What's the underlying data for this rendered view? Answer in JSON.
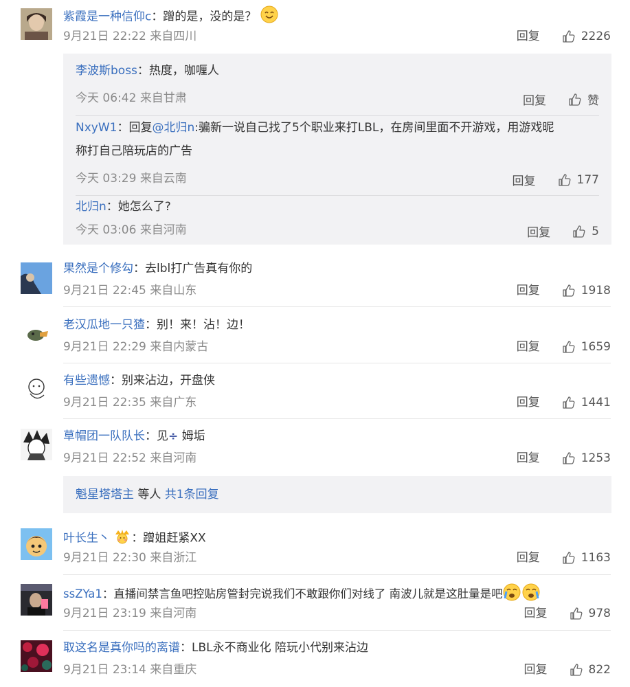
{
  "colors": {
    "link": "#3a6fbe",
    "meta": "#8a8a8a",
    "reply_bg": "#f2f2f4",
    "divider": "#e6e6e6"
  },
  "common": {
    "reply_label": "回复",
    "like_icon": "thumbs-up-icon"
  },
  "comments": [
    {
      "user": "紫霞是一种信仰c",
      "text": "：蹭的是，没的是？",
      "emoji": "smile-emoji",
      "date": "9月21日 22:22",
      "location": "来自四川",
      "likes": "2226",
      "replies": [
        {
          "user": "李波斯boss",
          "text": "：热度，咖喱人",
          "date": "今天 06:42",
          "location": "来自甘肃",
          "likes": "赞"
        },
        {
          "user": "NxyW1",
          "text_prefix": "：回复",
          "mention": "@北归n",
          "text": ":骗新一说自己找了5个职业来打LBL，在房间里面不开游戏，用游戏昵",
          "text2": "称打自己陪玩店的广告",
          "date": "今天 03:29",
          "location": "来自云南",
          "likes": "177"
        },
        {
          "user": "北归n",
          "text": "：她怎么了?",
          "date": "今天 03:06",
          "location": "来自河南",
          "likes": "5"
        }
      ]
    },
    {
      "user": "果然是个修勾",
      "text": "：去lbl打广告真有你的",
      "date": "9月21日 22:45",
      "location": "来自山东",
      "likes": "1918"
    },
    {
      "user": "老汉瓜地一只猹",
      "text": "：别！来！沾！边！",
      "date": "9月21日 22:29",
      "location": "来自内蒙古",
      "likes": "1659"
    },
    {
      "user": "有些遗憾",
      "text": "：别来沾边，开盘侠",
      "date": "9月21日 22:35",
      "location": "来自广东",
      "likes": "1441"
    },
    {
      "user": "草帽团一队队长",
      "text_a": "：见",
      "symbol": "÷",
      "text_b": " 姆垢",
      "date": "9月21日 22:52",
      "location": "来自河南",
      "likes": "1253",
      "more": {
        "user": "魁星塔塔主",
        "middle": " 等人 ",
        "link": "共1条回复"
      }
    },
    {
      "user": "叶长生丶",
      "badge": "crown-emoji",
      "text": "：蹭姐赶紧XX",
      "date": "9月21日 22:30",
      "location": "来自浙江",
      "likes": "1163"
    },
    {
      "user": "ssZYa1",
      "text": "：直播间禁言鱼吧控贴房管封完说我们不敢跟你们对线了 南波儿就是这肚量是吧",
      "emoji": "crying-emoji",
      "date": "9月21日 23:19",
      "location": "来自河南",
      "likes": "978"
    },
    {
      "user": "取这名是真你吗的离谱",
      "text": "：LBL永不商业化 陪玩小代别来沾边",
      "date": "9月21日 23:14",
      "location": "来自重庆",
      "likes": "822"
    }
  ]
}
